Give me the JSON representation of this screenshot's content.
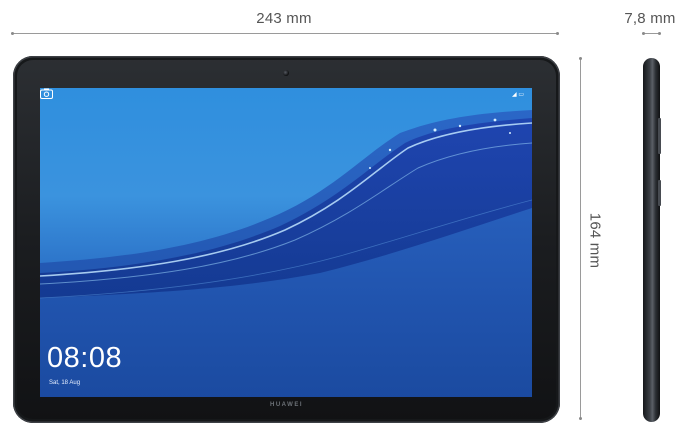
{
  "dimensions": {
    "width": "243 mm",
    "thickness": "7,8 mm",
    "height": "164 mm"
  },
  "screen": {
    "time": "08:08",
    "date": "Sat, 18 Aug"
  },
  "tablet": {
    "brand": "HUAWEI"
  },
  "colors": {
    "bezel": "#1b1d20",
    "screen_top": "#2f8fde",
    "screen_bottom": "#1a4fa4",
    "wave": "#1e3d9c"
  },
  "icons": {
    "camera_shortcut": "camera-icon",
    "front_camera": "front-camera-icon"
  }
}
